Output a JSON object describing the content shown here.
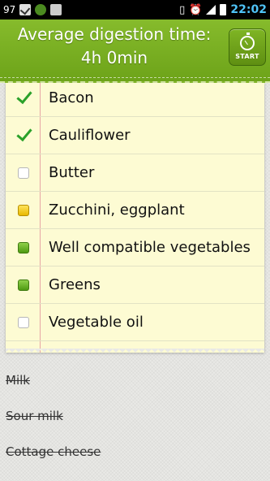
{
  "status_bar": {
    "notification_count": "97",
    "time": "22:02",
    "colors": {
      "background": "#000000",
      "time": "#4fc3f7"
    }
  },
  "header": {
    "title_line1": "Average digestion time:",
    "title_line2": "4h 0min",
    "start_button_label": "START",
    "colors": {
      "bar": "#76ab22",
      "button": "#5f8f12"
    }
  },
  "list": {
    "items": [
      {
        "label": "Bacon",
        "marker": "checkmark"
      },
      {
        "label": "Cauliflower",
        "marker": "checkmark"
      },
      {
        "label": "Butter",
        "marker": "empty-square"
      },
      {
        "label": "Zucchini, eggplant",
        "marker": "yellow-square"
      },
      {
        "label": "Well compatible vegetables",
        "marker": "green-square"
      },
      {
        "label": "Greens",
        "marker": "green-square"
      },
      {
        "label": "Vegetable oil",
        "marker": "empty-square"
      }
    ],
    "colors": {
      "paper": "#fdfbd3",
      "margin_line": "#e7a5a5",
      "check": "#2aa12a"
    }
  },
  "removed_items": [
    "Milk",
    "Sour milk",
    "Cottage cheese"
  ]
}
